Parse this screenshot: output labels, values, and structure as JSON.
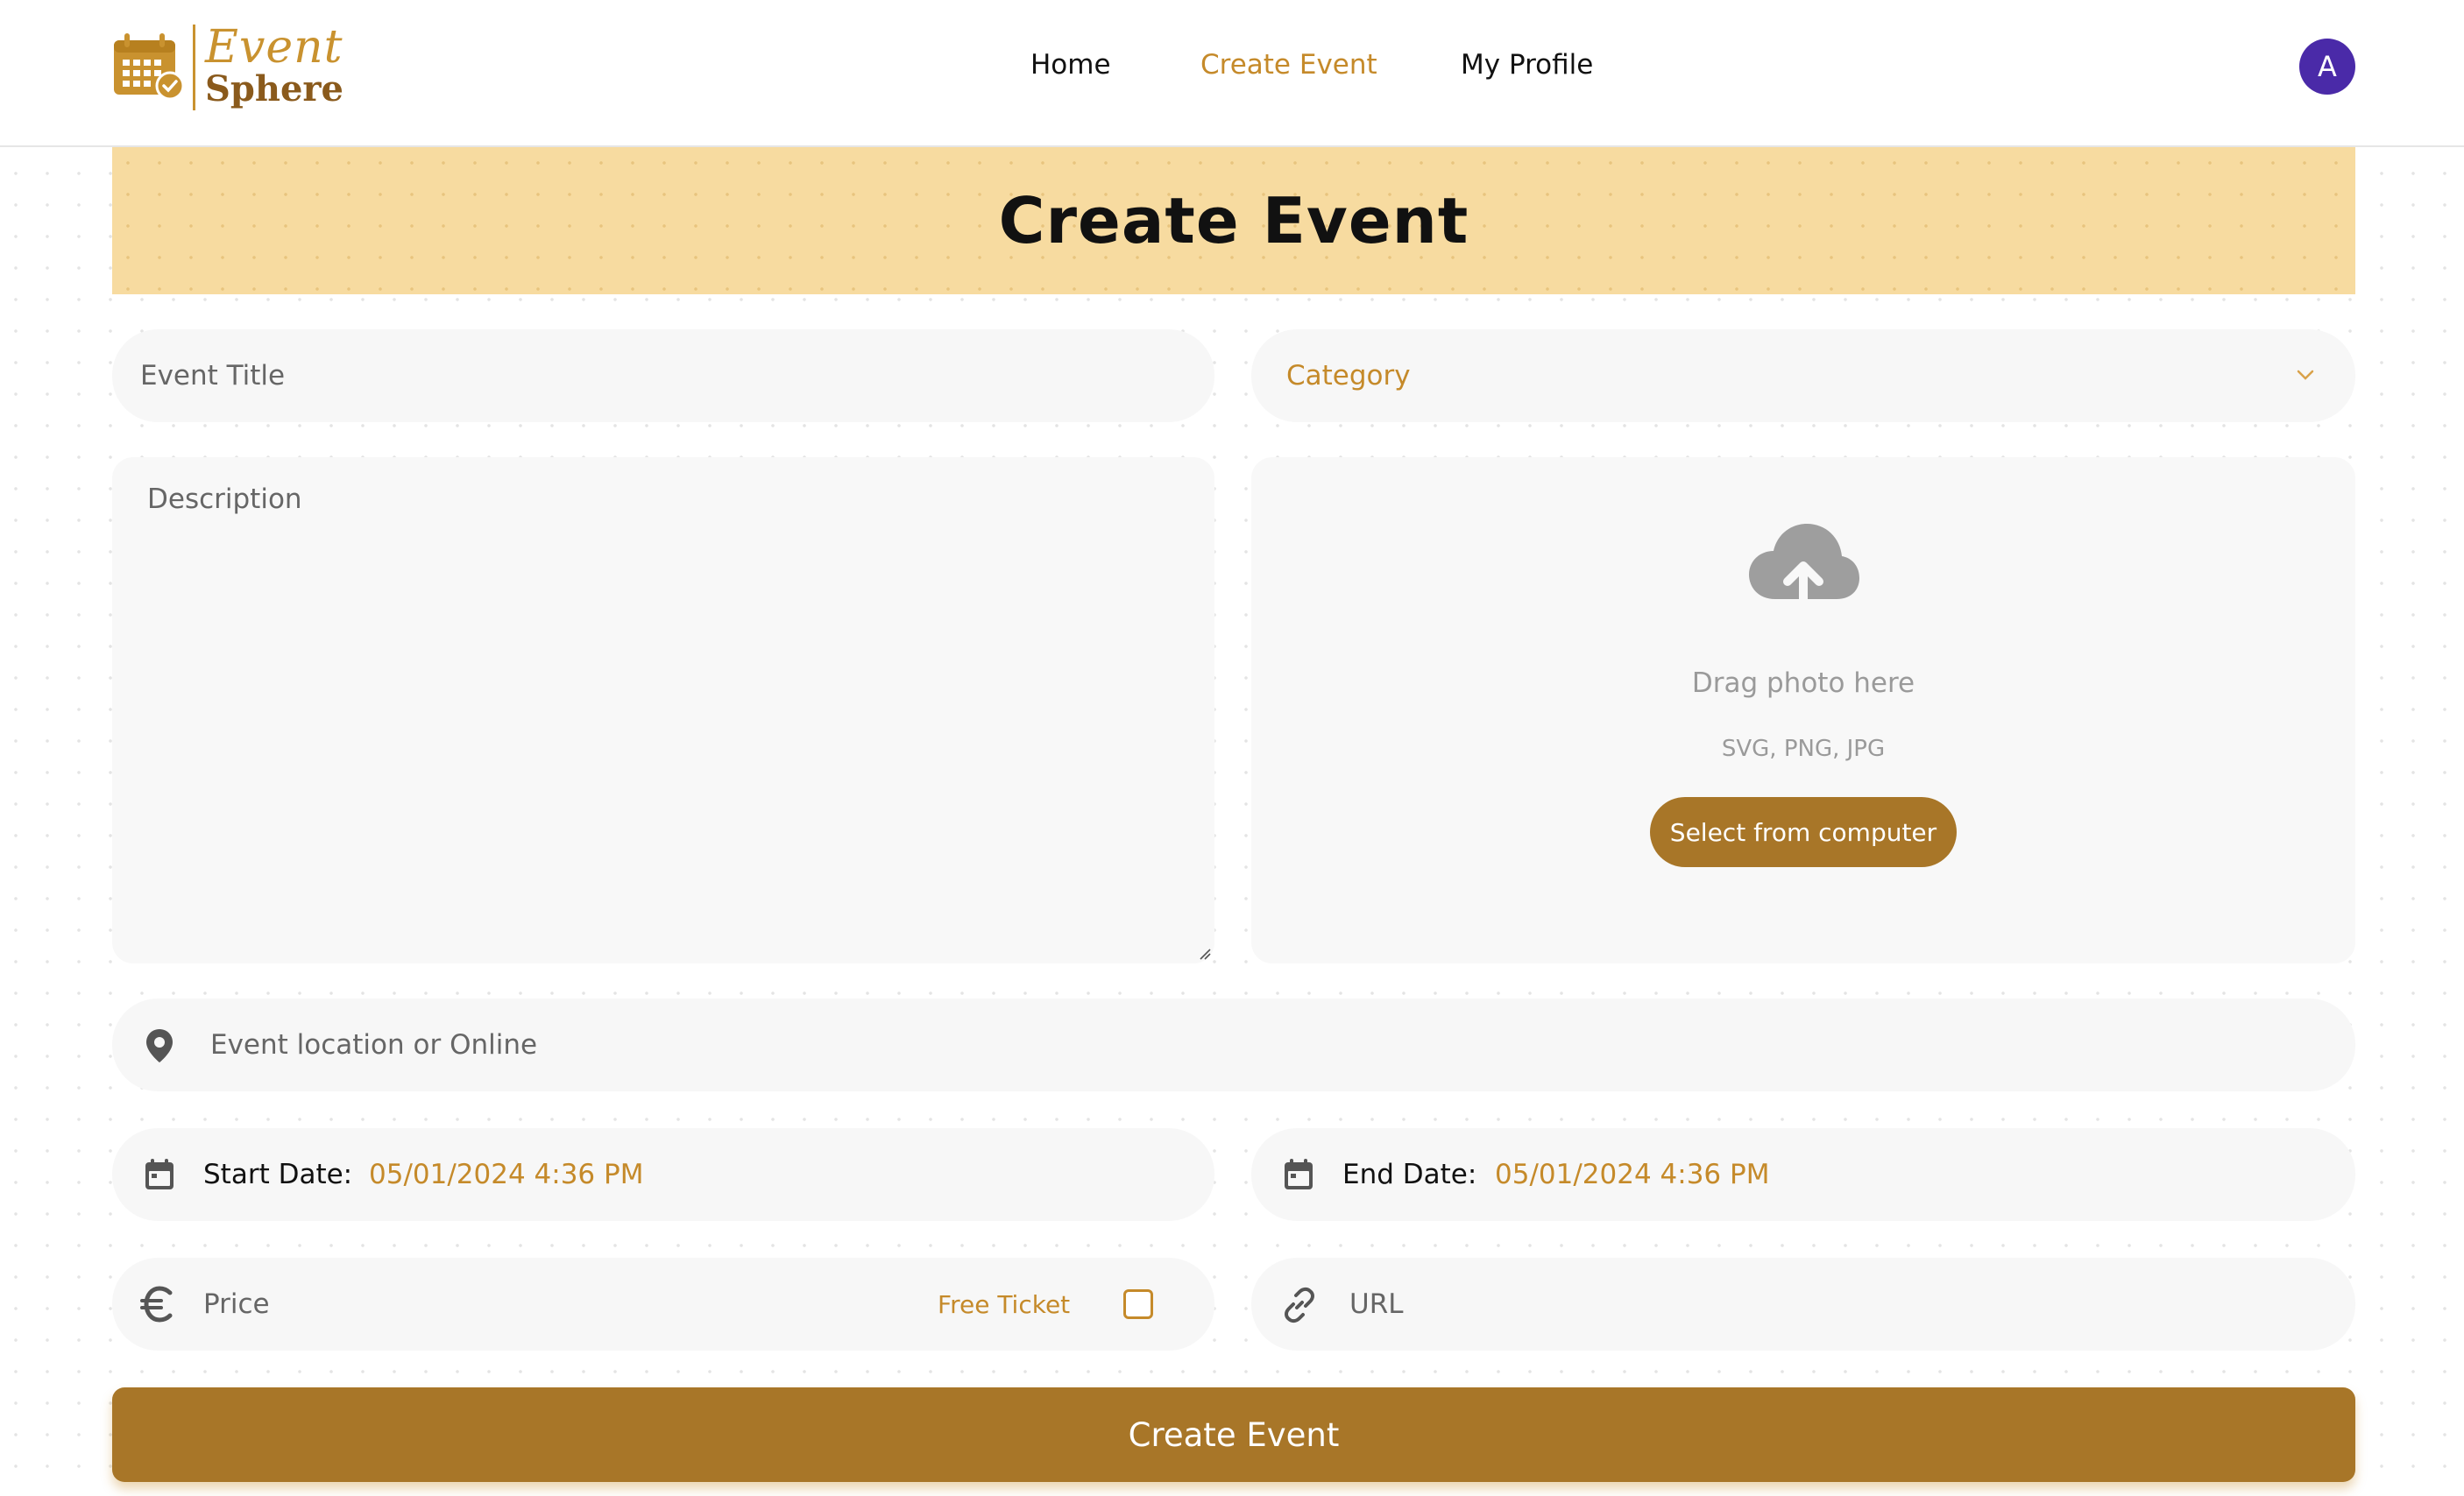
{
  "brand": {
    "line1": "Event",
    "line2": "Sphere"
  },
  "nav": {
    "home": "Home",
    "create_event": "Create Event",
    "my_profile": "My Profile"
  },
  "user": {
    "avatar_initial": "A"
  },
  "page": {
    "title": "Create Event"
  },
  "form": {
    "title_placeholder": "Event Title",
    "category_placeholder": "Category",
    "description_placeholder": "Description",
    "upload": {
      "drag_text": "Drag photo here",
      "formats": "SVG, PNG, JPG",
      "button": "Select from computer"
    },
    "location_placeholder": "Event location or Online",
    "start_date": {
      "label": "Start Date:",
      "value": "05/01/2024 4:36 PM"
    },
    "end_date": {
      "label": "End Date:",
      "value": "05/01/2024 4:36 PM"
    },
    "price_placeholder": "Price",
    "free_ticket_label": "Free Ticket",
    "url_placeholder": "URL",
    "submit_label": "Create Event"
  },
  "colors": {
    "accent": "#a87628",
    "accent_text": "#c58a2a",
    "banner": "#f7dba0",
    "avatar": "#4a2aa8"
  },
  "icons": [
    "calendar-logo-icon",
    "chevron-down-icon",
    "cloud-upload-icon",
    "location-pin-icon",
    "calendar-icon",
    "euro-icon",
    "link-icon"
  ]
}
